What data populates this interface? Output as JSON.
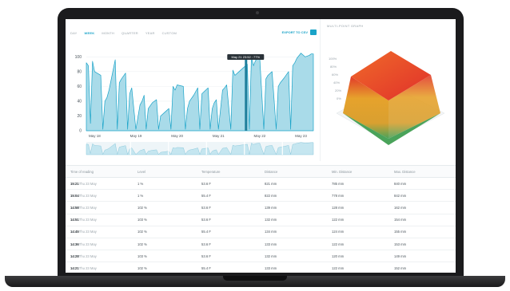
{
  "tabs": [
    "DAY",
    "WEEK",
    "MONTH",
    "QUARTER",
    "YEAR",
    "CUSTOM"
  ],
  "active_tab": "WEEK",
  "export_label": "EXPORT TO CSV",
  "colors": {
    "accent": "#1aa3c8",
    "fill": "#a9dbe9",
    "surface_top": "#e23b2a",
    "surface_mid": "#e6a22c",
    "surface_low": "#4aa35a"
  },
  "chart_data": [
    {
      "type": "area",
      "yticks": [
        100,
        80,
        60,
        40,
        20,
        0
      ],
      "ylim": [
        0,
        110
      ],
      "xticks": [
        "May 18",
        "May 19",
        "May 20",
        "May 21",
        "May 22",
        "May 23"
      ],
      "tooltip": "May 21 23:52 : 77%",
      "series": [
        {
          "x": [
            0.0,
            0.05,
            0.1,
            0.15,
            0.2,
            0.35,
            0.4,
            0.45,
            0.5,
            0.55,
            0.7,
            0.75,
            0.8,
            0.85,
            0.95,
            1.0,
            1.05,
            1.1,
            1.2,
            1.3,
            1.35,
            1.4,
            1.45,
            1.5,
            1.6,
            1.7,
            1.75,
            1.8,
            1.9,
            2.0,
            2.05,
            2.1,
            2.15,
            2.2,
            2.35,
            2.4,
            2.45,
            2.5,
            2.6,
            2.7,
            2.75,
            2.8,
            2.95,
            3.0,
            3.05,
            3.1,
            3.15,
            3.2,
            3.3,
            3.35,
            3.4,
            3.5,
            3.55,
            3.6,
            3.7,
            3.8,
            3.9,
            3.95,
            4.0,
            4.05,
            4.1,
            4.2,
            4.3,
            4.35,
            4.4,
            4.5,
            4.6,
            4.65,
            4.7,
            4.8,
            4.9,
            4.95,
            5.0,
            5.05,
            5.1,
            5.2,
            5.3,
            5.4,
            5.45,
            5.5
          ],
          "y": [
            92,
            88,
            10,
            94,
            80,
            75,
            2,
            40,
            45,
            55,
            96,
            2,
            65,
            70,
            78,
            2,
            50,
            58,
            2,
            35,
            40,
            48,
            2,
            30,
            38,
            42,
            2,
            20,
            25,
            30,
            2,
            60,
            55,
            62,
            60,
            2,
            30,
            40,
            48,
            58,
            2,
            50,
            58,
            2,
            30,
            38,
            42,
            2,
            55,
            58,
            62,
            2,
            82,
            75,
            80,
            85,
            90,
            2,
            100,
            88,
            95,
            100,
            2,
            70,
            75,
            80,
            2,
            60,
            65,
            72,
            80,
            2,
            88,
            92,
            98,
            105,
            100,
            102,
            104,
            104
          ]
        }
      ]
    },
    {
      "type": "surface",
      "title": "MULTI-POINT GRAPH",
      "zticks": [
        "100%",
        "80%",
        "60%",
        "40%",
        "20%",
        "0%"
      ]
    }
  ],
  "table": {
    "headers": [
      "Time of reading",
      "Level",
      "Temperature",
      "Distance",
      "Min. Distance",
      "Max. Distance"
    ],
    "rows": [
      {
        "time": "15:21",
        "date": "Thu 23 May",
        "level": "1 %",
        "temp": "53.6 F",
        "dist": "821 mm",
        "min": "785 mm",
        "max": "840 mm"
      },
      {
        "time": "15:04",
        "date": "Thu 23 May",
        "level": "1 %",
        "temp": "55.4 F",
        "dist": "822 mm",
        "min": "778 mm",
        "max": "842 mm"
      },
      {
        "time": "14:58",
        "date": "Thu 23 May",
        "level": "102 %",
        "temp": "53.6 F",
        "dist": "139 mm",
        "min": "128 mm",
        "max": "162 mm"
      },
      {
        "time": "14:51",
        "date": "Thu 23 May",
        "level": "103 %",
        "temp": "53.6 F",
        "dist": "132 mm",
        "min": "122 mm",
        "max": "154 mm"
      },
      {
        "time": "14:45",
        "date": "Thu 23 May",
        "level": "102 %",
        "temp": "55.4 F",
        "dist": "134 mm",
        "min": "124 mm",
        "max": "155 mm"
      },
      {
        "time": "14:36",
        "date": "Thu 23 May",
        "level": "102 %",
        "temp": "53.6 F",
        "dist": "133 mm",
        "min": "122 mm",
        "max": "153 mm"
      },
      {
        "time": "14:28",
        "date": "Thu 23 May",
        "level": "103 %",
        "temp": "53.6 F",
        "dist": "132 mm",
        "min": "120 mm",
        "max": "149 mm"
      },
      {
        "time": "14:21",
        "date": "Thu 23 May",
        "level": "102 %",
        "temp": "55.4 F",
        "dist": "133 mm",
        "min": "122 mm",
        "max": "152 mm"
      }
    ]
  }
}
